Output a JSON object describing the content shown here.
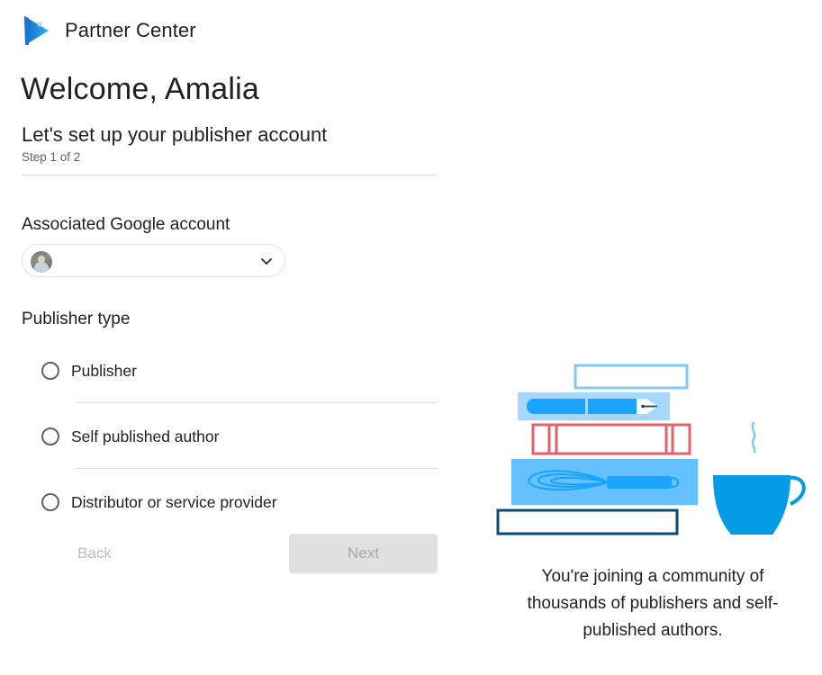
{
  "header": {
    "app_title": "Partner Center",
    "logo_icon": "google-play-books-logo"
  },
  "welcome": {
    "title": "Welcome, Amalia",
    "subtitle": "Let's set up your publisher account",
    "step": "Step 1 of 2"
  },
  "account": {
    "label": "Associated Google account",
    "selected_value": "",
    "avatar_icon": "user-avatar",
    "dropdown_icon": "chevron-down-icon"
  },
  "publisher_type": {
    "label": "Publisher type",
    "options": [
      {
        "label": "Publisher",
        "selected": false
      },
      {
        "label": "Self published author",
        "selected": false
      },
      {
        "label": "Distributor or service provider",
        "selected": false
      }
    ]
  },
  "actions": {
    "back_label": "Back",
    "next_label": "Next",
    "back_disabled": true,
    "next_disabled": true
  },
  "illustration": {
    "caption": "You're joining a community of thousands of publishers and self-published authors.",
    "colors": {
      "light_blue": "#81c9f7",
      "pale_blue": "#a5d8fc",
      "blue": "#1aa3ff",
      "red": "#e5606b",
      "navy": "#0b4a7d",
      "cup": "#039be5"
    }
  }
}
